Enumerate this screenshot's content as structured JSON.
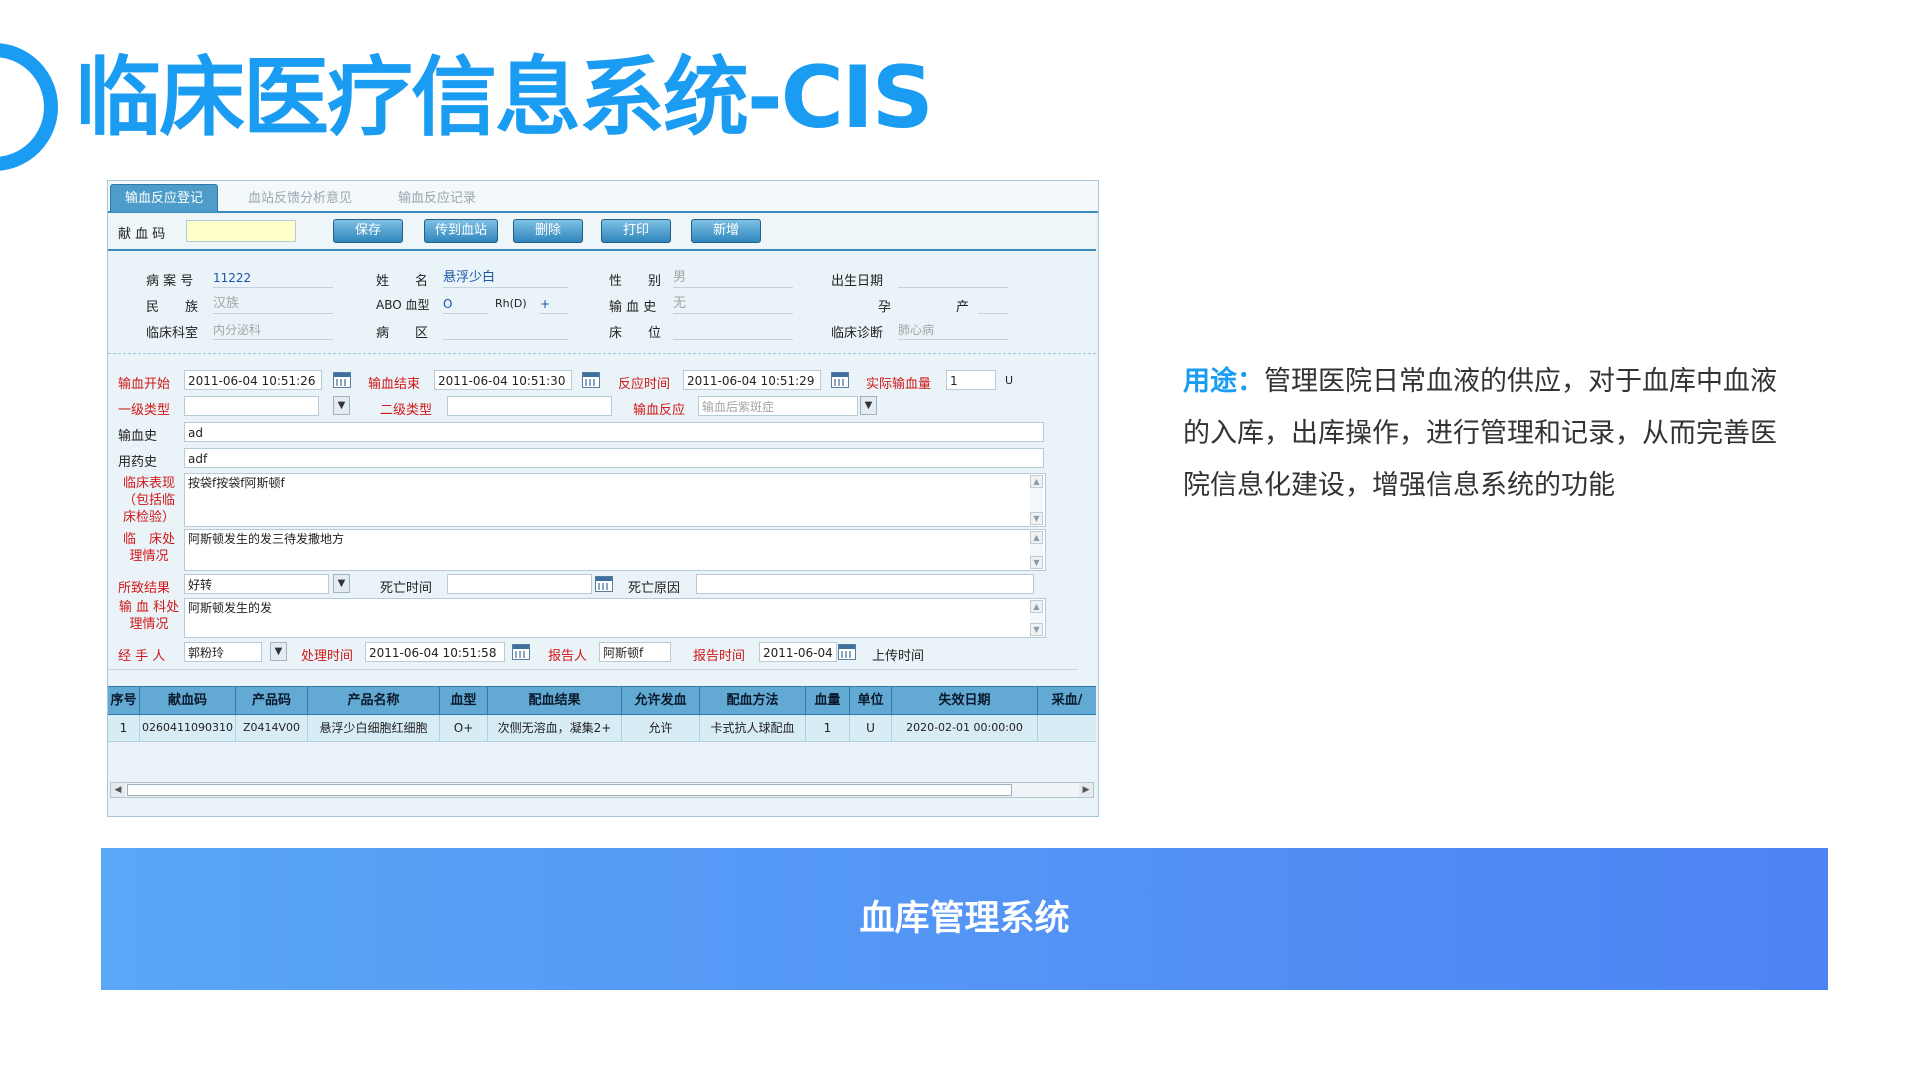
{
  "slide": {
    "title": "临床医疗信息系统-CIS",
    "desc_key": "用途：",
    "desc_body": "管理医院日常血液的供应，对于血库中血液的入库，出库操作，进行管理和记录，从而完善医院信息化建设，增强信息系统的功能",
    "banner": "血库管理系统"
  },
  "tabs": [
    "输血反应登记",
    "血站反馈分析意见",
    "输血反应记录"
  ],
  "toolbar": {
    "donor_code_label": "献 血 码",
    "donor_code_value": "",
    "buttons": [
      "保存",
      "传到血站",
      "删除",
      "打印",
      "新增"
    ]
  },
  "patient": {
    "record_no_label": "病 案 号",
    "record_no": "11222",
    "name_label": "姓　　名",
    "name": "悬浮少白",
    "sex_label": "性　　别",
    "sex": "男",
    "birth_label": "出生日期",
    "birth": "",
    "ethnic_label": "民　　族",
    "ethnic": "汉族",
    "abo_label": "ABO 血型",
    "abo": "O",
    "rh_label": "Rh(D)",
    "rh": "+",
    "transfusion_hist_label": "输 血 史",
    "transfusion_hist": "无",
    "pregnancy_label": "孕",
    "birth_count_label": "产",
    "dept_label": "临床科室",
    "dept": "内分泌科",
    "ward_label": "病　　区",
    "ward": "",
    "bed_label": "床　　位",
    "bed": "",
    "diagnosis_label": "临床诊断",
    "diagnosis": "肺心病"
  },
  "form": {
    "start_label": "输血开始",
    "start": "2011-06-04 10:51:26",
    "end_label": "输血结束",
    "end": "2011-06-04 10:51:30",
    "react_time_label": "反应时间",
    "react_time": "2011-06-04 10:51:29",
    "actual_label": "实际输血量",
    "actual": "1",
    "actual_unit": "U",
    "type1_label": "一级类型",
    "type1": "",
    "type2_label": "二级类型",
    "type2": "",
    "reaction_label": "输血反应",
    "reaction": "输血后紫斑症",
    "hist_label": "输血史",
    "hist": "ad",
    "drug_label": "用药史",
    "drug": "adf",
    "clinical_label": "临床表现（包括临床检验）",
    "clinical": "按袋f按袋f阿斯顿f",
    "treat_label": "临　床处理情况",
    "treat": "阿斯顿发生的发三待发撒地方",
    "result_label": "所致结果",
    "result": "好转",
    "death_time_label": "死亡时间",
    "death_time": "",
    "death_cause_label": "死亡原因",
    "death_cause": "",
    "dept_treat_label": "输 血 科处理情况",
    "dept_treat": "阿斯顿发生的发",
    "handler_label": "经 手 人",
    "handler": "郭粉玲",
    "handle_time_label": "处理时间",
    "handle_time": "2011-06-04 10:51:58",
    "reporter_label": "报告人",
    "reporter": "阿斯顿f",
    "report_time_label": "报告时间",
    "report_time": "2011-06-04",
    "upload_label": "上传时间"
  },
  "table": {
    "headers": [
      "序号",
      "献血码",
      "产品码",
      "产品名称",
      "血型",
      "配血结果",
      "允许发血",
      "配血方法",
      "血量",
      "单位",
      "失效日期",
      "采血/"
    ],
    "rows": [
      [
        "1",
        "0260411090310",
        "Z0414V00",
        "悬浮少白细胞红细胞",
        "O+",
        "次侧无溶血，凝集2+",
        "允许",
        "卡式抗人球配血",
        "1",
        "U",
        "2020-02-01 00:00:00",
        ""
      ]
    ]
  },
  "colors": {
    "accent": "#1a9cf2",
    "header_bar": "#62a9d4",
    "red_label": "#d01818"
  }
}
